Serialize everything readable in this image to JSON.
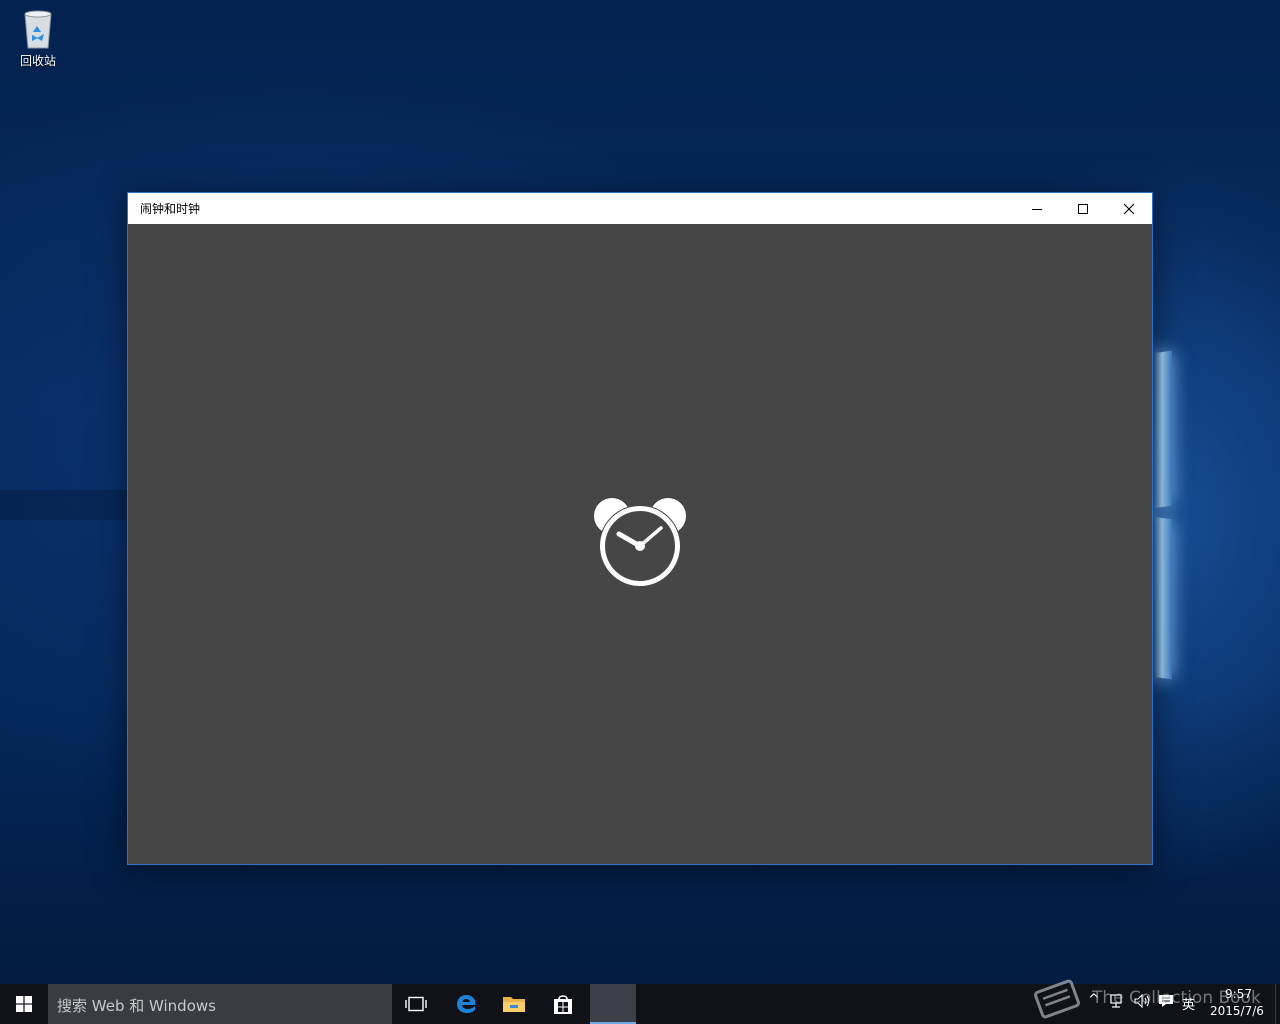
{
  "desktop": {
    "icons": [
      {
        "label": "回收站",
        "icon": "recycle-bin-icon"
      }
    ]
  },
  "window": {
    "title": "闹钟和时钟",
    "splash_icon": "alarm-clock-icon",
    "controls": [
      "minimize-icon",
      "maximize-icon",
      "close-icon"
    ],
    "content_bg": "#464646",
    "border_color": "#2f73c7"
  },
  "taskbar": {
    "search_placeholder": "搜索 Web 和 Windows",
    "items": [
      "start-icon",
      "task-view-icon",
      "edge-icon",
      "file-explorer-icon",
      "store-icon",
      "alarms-app-icon"
    ],
    "watermark": "The Collection Book",
    "tray": {
      "ime": "英",
      "time": "9:57",
      "date": "2015/7/6"
    }
  }
}
